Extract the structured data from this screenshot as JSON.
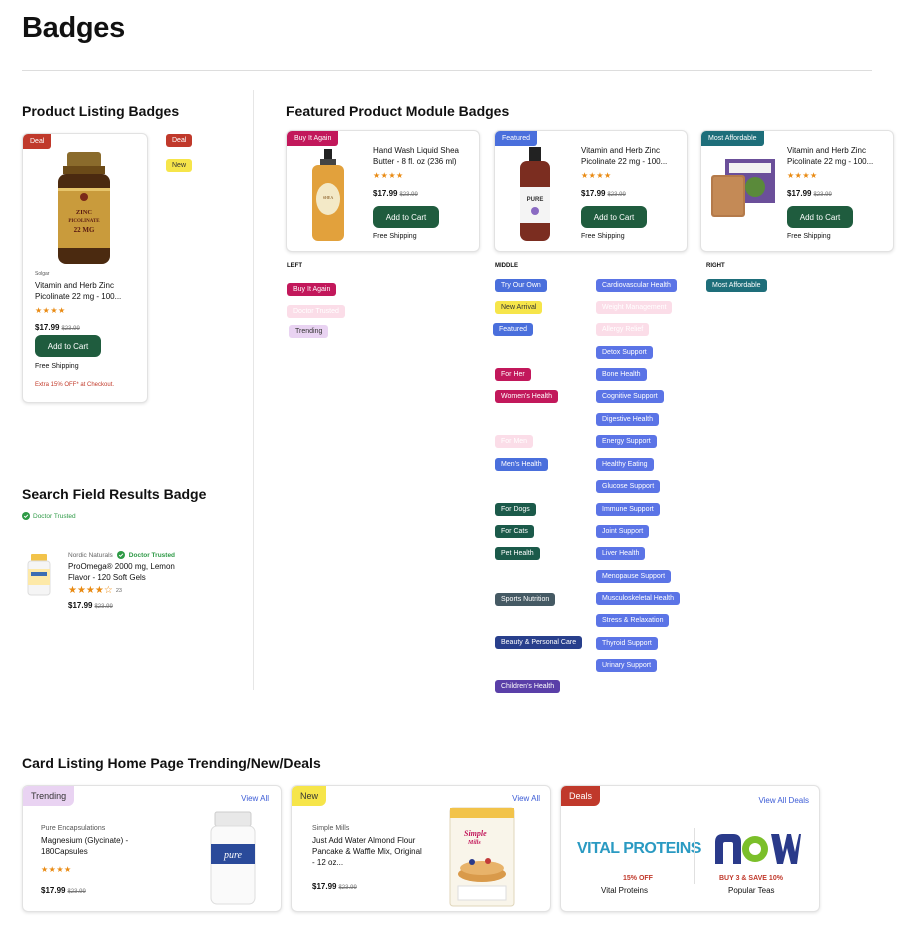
{
  "page": {
    "title": "Badges"
  },
  "colors": {
    "red": "#c0392b",
    "yellow": "#f6e54a",
    "green_button": "#1f5c3e",
    "blue": "#4a6fdc",
    "magenta": "#c2185b",
    "pink_light": "#fbdde8",
    "lavender": "#e9d3f2",
    "teal": "#1e6e7a",
    "dark_green": "#1b5a4a",
    "slate": "#455a64",
    "navy": "#283f8c",
    "purple": "#5a3fa8",
    "light_blue": "#5b74e6",
    "doctor_green": "#2e9a46"
  },
  "product_listing": {
    "title": "Product Listing Badges",
    "badge_deal": "Deal",
    "badge_new": "New",
    "card": {
      "badge": "Deal",
      "image_label": "ZINC PICOLINATE 22 MG",
      "brand": "Solgar",
      "name": "Vitamin and Herb   Zinc Picolinate 22 mg - 100...",
      "stars": "★★★★",
      "price": "$17.99",
      "old_price": "$23.99",
      "button": "Add to Cart",
      "shipping": "Free Shipping",
      "promo": "Extra 15% OFF* at Checkout."
    }
  },
  "search_field": {
    "title": "Search Field Results Badge",
    "badge": "Doctor Trusted",
    "brand": "Nordic Naturals",
    "doctor_badge": "Doctor Trusted",
    "name": "ProOmega® 2000 mg, Lemon Flavor - 120 Soft Gels",
    "stars": "★★★★☆",
    "reviews": "23",
    "price": "$17.99",
    "old_price": "$23.99"
  },
  "featured": {
    "title": "Featured Product Module Badges",
    "cards": [
      {
        "badge": "Buy It Again",
        "name": "Hand Wash Liquid Shea Butter - 8 fl. oz (236 ml)",
        "stars": "★★★★",
        "price": "$17.99",
        "old_price": "$23.99",
        "button": "Add to Cart",
        "shipping": "Free Shipping"
      },
      {
        "badge": "Featured",
        "name": "Vitamin and Herb   Zinc Picolinate 22 mg - 100...",
        "stars": "★★★★",
        "price": "$17.99",
        "old_price": "$23.99",
        "button": "Add to Cart",
        "shipping": "Free Shipping"
      },
      {
        "badge": "Most Affordable",
        "name": "Vitamin and Herb   Zinc Picolinate 22 mg - 100...",
        "stars": "★★★★",
        "price": "$17.99",
        "old_price": "$23.99",
        "button": "Add to Cart",
        "shipping": "Free Shipping"
      }
    ],
    "left_label": "LEFT",
    "middle_label": "MIDDLE",
    "right_label": "RIGHT",
    "left_badges": [
      "Buy It Again",
      "Doctor Trusted",
      "Trending"
    ],
    "middle_a": [
      "Try Our Own",
      "New Arrival",
      "Featured",
      "For Her",
      "Women's Health",
      "For Men",
      "Men's Health",
      "For Dogs",
      "For Cats",
      "Pet Health",
      "Sports Nutrition",
      "Beauty & Personal Care",
      "Children's Health"
    ],
    "middle_b": [
      "Cardiovascular Health",
      "Weight Management",
      "Allergy Relief",
      "Detox Support",
      "Bone Health",
      "Cognitive Support",
      "Digestive Health",
      "Energy Support",
      "Healthy Eating",
      "Glucose Support",
      "Immune Support",
      "Joint Support",
      "Liver Health",
      "Menopause Support",
      "Musculoskeletal Health",
      "Stress & Relaxation",
      "Thyroid Support",
      "Urinary Support"
    ],
    "right_badges": [
      "Most Affordable"
    ]
  },
  "card_listing": {
    "title": "Card Listing Home Page Trending/New/Deals",
    "cards": [
      {
        "badge": "Trending",
        "link": "View All",
        "brand": "Pure Encapsulations",
        "name": "Magnesium (Glycinate) - 180Capsules",
        "stars": "★★★★",
        "price": "$17.99",
        "old_price": "$23.99",
        "image_label": "pure"
      },
      {
        "badge": "New",
        "link": "View All",
        "brand": "Simple Mills",
        "name": "Just Add Water Almond Flour Pancake & Waffle Mix, Original - 12 oz...",
        "price": "$17.99",
        "old_price": "$23.99",
        "image_label": "Simple Mills"
      },
      {
        "badge": "Deals",
        "link": "View All Deals",
        "deal1_logo": "VITAL PROTEINS",
        "deal1_offer": "15% OFF",
        "deal1_name": "Vital Proteins",
        "deal2_logo": "now",
        "deal2_offer": "BUY 3 & SAVE 10%",
        "deal2_name": "Popular Teas"
      }
    ]
  }
}
